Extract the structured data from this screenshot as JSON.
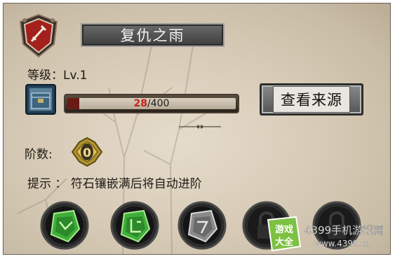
{
  "title": "复仇之雨",
  "level": {
    "label": "等级：Lv.1"
  },
  "progress": {
    "current": "28",
    "max": "/400",
    "fraction": 0.07
  },
  "source_button": {
    "label": "查看来源"
  },
  "stage": {
    "label": "阶数:",
    "value": "0"
  },
  "hint": {
    "text": "提示 ： 符石镶嵌满后将自动进阶"
  },
  "icons": {
    "badge": "sword-shield-icon",
    "pack": "rune-pack-icon",
    "divider": "ornament-divider-icon",
    "stage_badge": "stage-medal-icon"
  },
  "slots": [
    {
      "name": "green-rune-slot-1",
      "color": "#3fae3a",
      "state": "filled"
    },
    {
      "name": "green-rune-slot-2",
      "color": "#3fae3a",
      "state": "filled"
    },
    {
      "name": "grey-rune-slot",
      "color": "#8a8a8a",
      "state": "filled"
    },
    {
      "name": "locked-slot-1",
      "color": "#3a3a3a",
      "state": "locked"
    },
    {
      "name": "locked-slot-2",
      "color": "#3a3a3a",
      "state": "locked"
    }
  ],
  "watermark": {
    "logo_top": "游戏",
    "logo_bottom": "大全",
    "brand": "4399手机游戏网",
    "url": "www.4399.cn"
  },
  "colors": {
    "accent_red": "#c4221a",
    "panel_bg": "#d8ccb8",
    "watermark_green": "#7cc142"
  }
}
